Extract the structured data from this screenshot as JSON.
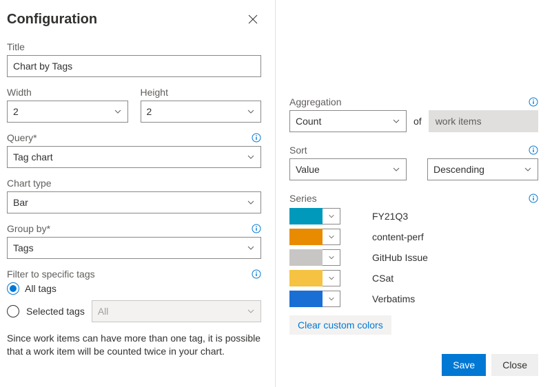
{
  "header": {
    "title": "Configuration"
  },
  "fields": {
    "title_label": "Title",
    "title_value": "Chart by Tags",
    "width_label": "Width",
    "width_value": "2",
    "height_label": "Height",
    "height_value": "2",
    "query_label": "Query*",
    "query_value": "Tag chart",
    "chart_type_label": "Chart type",
    "chart_type_value": "Bar",
    "group_by_label": "Group by*",
    "group_by_value": "Tags",
    "filter_label": "Filter to specific tags",
    "all_tags_label": "All tags",
    "selected_tags_label": "Selected tags",
    "selected_tags_placeholder": "All",
    "note": "Since work items can have more than one tag, it is possible that a work item will be counted twice in your chart."
  },
  "right": {
    "aggregation_label": "Aggregation",
    "aggregation_value": "Count",
    "of_label": "of",
    "aggregation_target": "work items",
    "sort_label": "Sort",
    "sort_field": "Value",
    "sort_dir": "Descending",
    "series_label": "Series",
    "series": [
      {
        "color": "#0099bc",
        "name": "FY21Q3"
      },
      {
        "color": "#e88b00",
        "name": "content-perf"
      },
      {
        "color": "#c8c6c4",
        "name": "GitHub Issue"
      },
      {
        "color": "#f5c242",
        "name": "CSat"
      },
      {
        "color": "#1a6fd4",
        "name": "Verbatims"
      }
    ],
    "clear_colors_label": "Clear custom colors"
  },
  "footer": {
    "save_label": "Save",
    "close_label": "Close"
  }
}
